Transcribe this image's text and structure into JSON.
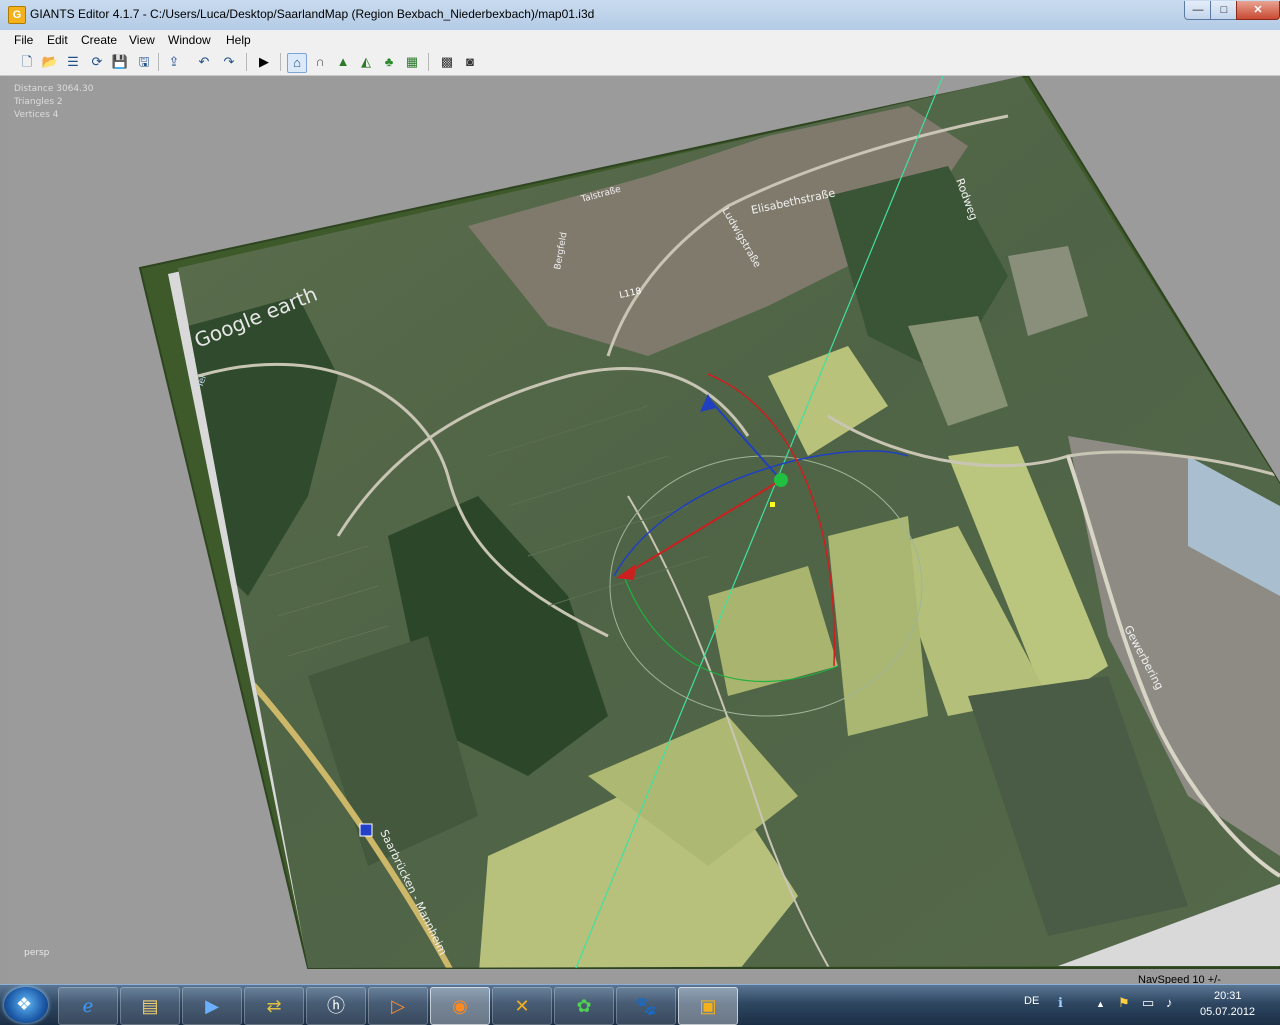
{
  "window": {
    "title": "GIANTS Editor 4.1.7 - C:/Users/Luca/Desktop/SaarlandMap (Region Bexbach_Niederbexbach)/map01.i3d",
    "icon": "giants-app-icon",
    "controls": {
      "minimize": "—",
      "maximize": "□",
      "close": "✕"
    }
  },
  "menu": {
    "items": [
      "File",
      "Edit",
      "Create",
      "View",
      "Window",
      "Help"
    ]
  },
  "toolbar": {
    "icons": [
      "new-file-icon",
      "open-file-icon",
      "properties-icon",
      "refresh-icon",
      "save-icon",
      "save-as-icon",
      "import-icon",
      "undo-icon",
      "redo-icon",
      "play-icon",
      "select-home-icon",
      "magnet-icon",
      "terrain-sculpt-icon",
      "terrain-paint-icon",
      "foliage-paint-icon",
      "texture-paint-icon",
      "checker-icon",
      "checker-settings-icon"
    ]
  },
  "viewport": {
    "stats": {
      "distance": "Distance 3064.30",
      "triangles": "Triangles 2",
      "vertices": "Vertices 4"
    },
    "camera_mode": "persp",
    "nav_speed": "NavSpeed 10 +/-",
    "map_labels": {
      "watermark": "Google earth",
      "street_1": "Elisabethstraße",
      "street_2": "Rodweg",
      "street_3": "Gewerbering",
      "street_4": "Ludwigstraße",
      "road_number": "L118",
      "highway": "Saarbrücken - Mannheim",
      "left_edge": "Tel",
      "street_5": "Talstraße",
      "street_6": "Bergfeld"
    },
    "colors": {
      "gizmo_x": "#cc2020",
      "gizmo_y": "#2040c0",
      "gizmo_z": "#20b040",
      "guide_line": "#40e0a0"
    }
  },
  "taskbar": {
    "apps": [
      "start-orb",
      "internet-explorer-icon",
      "explorer-folder-icon",
      "media-player-icon",
      "giants-export-icon",
      "hp-icon",
      "media-center-icon",
      "firefox-icon",
      "network-tools-icon",
      "icq-icon",
      "gimp-icon",
      "giants-editor-icon"
    ],
    "language": "DE",
    "time": "20:31",
    "date": "05.07.2012"
  }
}
